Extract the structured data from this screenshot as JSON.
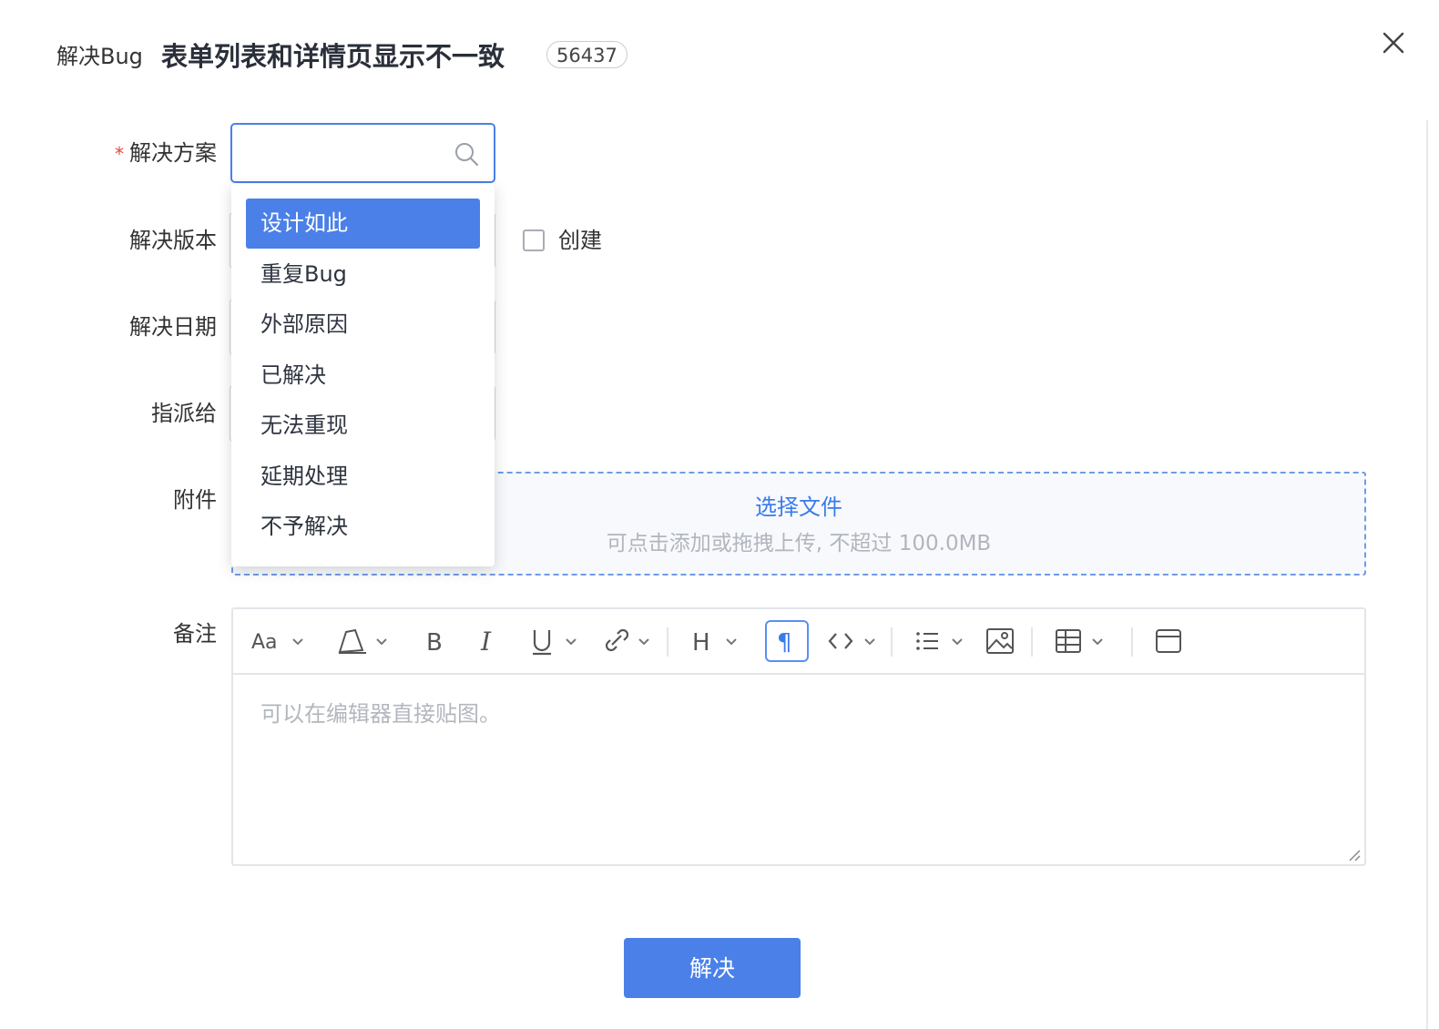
{
  "dialog": {
    "prefix": "解决Bug",
    "title": "表单列表和详情页显示不一致",
    "bug_id": "56437"
  },
  "form": {
    "solution_label": "解决方案",
    "required_mark": "*",
    "solution_placeholder": "",
    "version_label": "解决版本",
    "date_label": "解决日期",
    "assign_label": "指派给",
    "attachment_label": "附件",
    "notes_label": "备注",
    "create_label": "创建"
  },
  "dropdown": {
    "items": [
      "设计如此",
      "重复Bug",
      "外部原因",
      "已解决",
      "无法重现",
      "延期处理",
      "不予解决"
    ],
    "selected_index": 0
  },
  "upload": {
    "button": "选择文件",
    "hint": "可点击添加或拖拽上传, 不超过 100.0MB"
  },
  "editor": {
    "placeholder": "可以在编辑器直接贴图。",
    "toolbar": [
      "font-size",
      "highlight",
      "bold",
      "italic",
      "underline",
      "link",
      "heading",
      "paragraph",
      "code",
      "list",
      "image",
      "table",
      "layout"
    ]
  },
  "submit": {
    "label": "解决"
  },
  "colors": {
    "primary": "#4a80e8",
    "required": "#e5453b",
    "placeholder": "#b3b7be"
  }
}
